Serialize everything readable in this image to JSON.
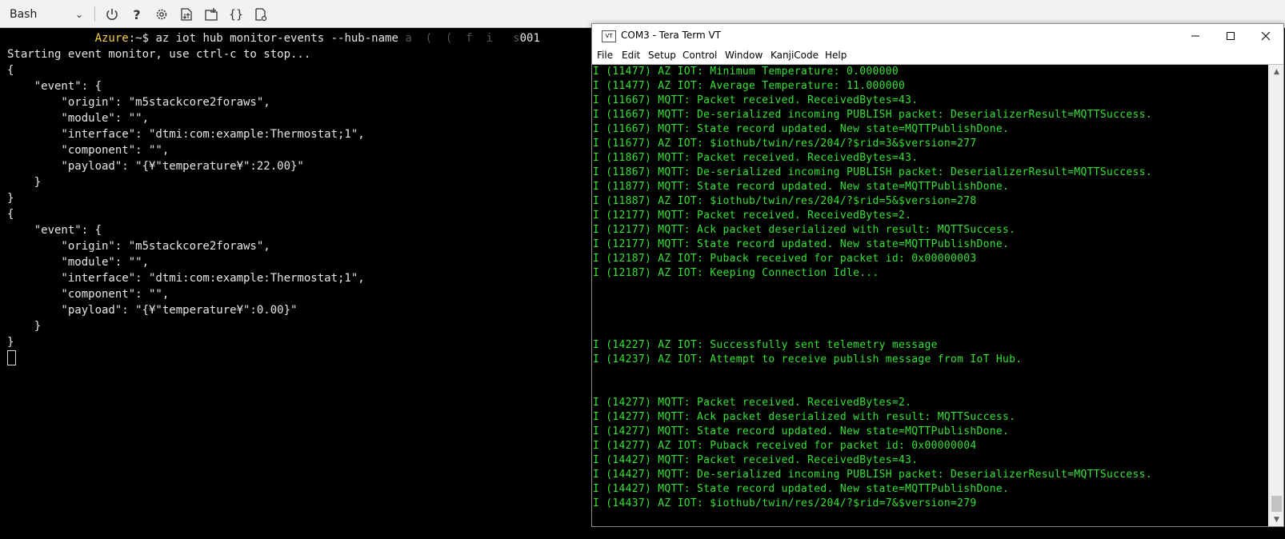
{
  "cloud_shell": {
    "shell_selector": "Bash",
    "icons": [
      "power-icon",
      "help-icon",
      "settings-icon",
      "upload-download-icon",
      "open-new-session-icon",
      "editor-braces-icon",
      "web-preview-icon"
    ]
  },
  "bash": {
    "lines": [
      {
        "user": "Azure",
        "text": ":~$ az iot hub monitor-events --hub-name ",
        "redacted": "a  (  (  f  i   s",
        "tail": "001"
      },
      {
        "text": "Starting event monitor, use ctrl-c to stop..."
      },
      {
        "text": "{"
      },
      {
        "text": "    \"event\": {"
      },
      {
        "text": "        \"origin\": \"m5stackcore2foraws\","
      },
      {
        "text": "        \"module\": \"\","
      },
      {
        "text": "        \"interface\": \"dtmi:com:example:Thermostat;1\","
      },
      {
        "text": "        \"component\": \"\","
      },
      {
        "text": "        \"payload\": \"{¥\"temperature¥\":22.00}\""
      },
      {
        "text": "    }"
      },
      {
        "text": "}"
      },
      {
        "text": "{"
      },
      {
        "text": "    \"event\": {"
      },
      {
        "text": "        \"origin\": \"m5stackcore2foraws\","
      },
      {
        "text": "        \"module\": \"\","
      },
      {
        "text": "        \"interface\": \"dtmi:com:example:Thermostat;1\","
      },
      {
        "text": "        \"component\": \"\","
      },
      {
        "text": "        \"payload\": \"{¥\"temperature¥\":0.00}\""
      },
      {
        "text": "    }"
      },
      {
        "text": "}"
      }
    ]
  },
  "teraterm": {
    "title": "COM3 - Tera Term VT",
    "logo": "VT",
    "menu": [
      "File",
      "Edit",
      "Setup",
      "Control",
      "Window",
      "KanjiCode",
      "Help"
    ],
    "lines": [
      "I (11477) AZ IOT: Minimum Temperature: 0.000000",
      "I (11477) AZ IOT: Average Temperature: 11.000000",
      "I (11667) MQTT: Packet received. ReceivedBytes=43.",
      "I (11667) MQTT: De-serialized incoming PUBLISH packet: DeserializerResult=MQTTSuccess.",
      "I (11667) MQTT: State record updated. New state=MQTTPublishDone.",
      "I (11677) AZ IOT: $iothub/twin/res/204/?$rid=3&$version=277",
      "I (11867) MQTT: Packet received. ReceivedBytes=43.",
      "I (11867) MQTT: De-serialized incoming PUBLISH packet: DeserializerResult=MQTTSuccess.",
      "I (11877) MQTT: State record updated. New state=MQTTPublishDone.",
      "I (11887) AZ IOT: $iothub/twin/res/204/?$rid=5&$version=278",
      "I (12177) MQTT: Packet received. ReceivedBytes=2.",
      "I (12177) MQTT: Ack packet deserialized with result: MQTTSuccess.",
      "I (12177) MQTT: State record updated. New state=MQTTPublishDone.",
      "I (12187) AZ IOT: Puback received for packet id: 0x00000003",
      "I (12187) AZ IOT: Keeping Connection Idle...",
      "",
      "",
      "",
      "",
      "I (14227) AZ IOT: Successfully sent telemetry message",
      "I (14237) AZ IOT: Attempt to receive publish message from IoT Hub.",
      "",
      "",
      "I (14277) MQTT: Packet received. ReceivedBytes=2.",
      "I (14277) MQTT: Ack packet deserialized with result: MQTTSuccess.",
      "I (14277) MQTT: State record updated. New state=MQTTPublishDone.",
      "I (14277) AZ IOT: Puback received for packet id: 0x00000004",
      "I (14427) MQTT: Packet received. ReceivedBytes=43.",
      "I (14427) MQTT: De-serialized incoming PUBLISH packet: DeserializerResult=MQTTSuccess.",
      "I (14427) MQTT: State record updated. New state=MQTTPublishDone.",
      "I (14437) AZ IOT: $iothub/twin/res/204/?$rid=7&$version=279"
    ]
  },
  "colors": {
    "terminal_bg": "#000000",
    "bash_text": "#e6e6e6",
    "prompt_user": "#f3d04a",
    "teraterm_text": "#33e233"
  }
}
